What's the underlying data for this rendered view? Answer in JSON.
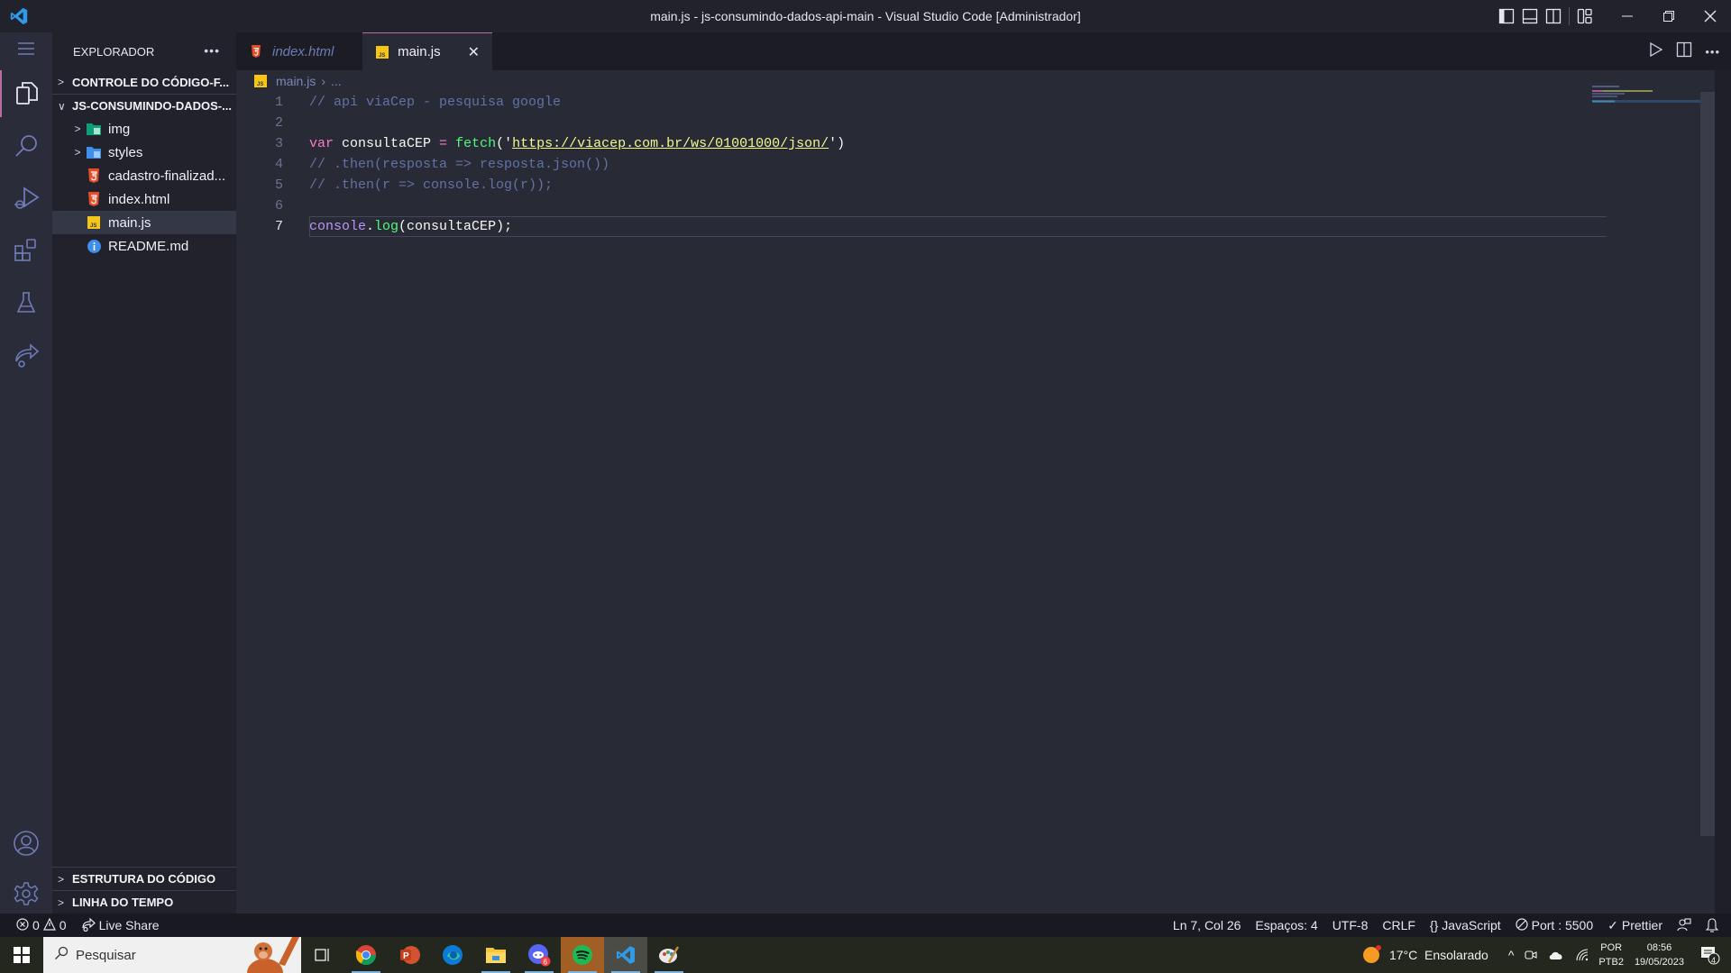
{
  "window": {
    "title": "main.js - js-consumindo-dados-api-main - Visual Studio Code [Administrador]"
  },
  "sidebar": {
    "header": "EXPLORADOR",
    "sections": {
      "source_control": "CONTROLE DO CÓDIGO-F...",
      "project": "JS-CONSUMINDO-DADOS-...",
      "outline": "ESTRUTURA DO CÓDIGO",
      "timeline": "LINHA DO TEMPO"
    },
    "files": [
      {
        "name": "img",
        "type": "folder-img"
      },
      {
        "name": "styles",
        "type": "folder-styles"
      },
      {
        "name": "cadastro-finalizad...",
        "type": "html"
      },
      {
        "name": "index.html",
        "type": "html"
      },
      {
        "name": "main.js",
        "type": "js",
        "selected": true
      },
      {
        "name": "README.md",
        "type": "info"
      }
    ]
  },
  "tabs": [
    {
      "label": "index.html",
      "type": "html",
      "active": false
    },
    {
      "label": "main.js",
      "type": "js",
      "active": true
    }
  ],
  "breadcrumb": {
    "file": "main.js",
    "rest": "..."
  },
  "editor": {
    "lines": [
      {
        "n": "1",
        "comment": "// api viaCep - pesquisa google"
      },
      {
        "n": "2"
      },
      {
        "n": "3",
        "kw": "var",
        "name": " consultaCEP ",
        "eq": "=",
        "fn": " fetch",
        "p1": "('",
        "str": "https://viacep.com.br/ws/01001000/json/",
        "p2": "')"
      },
      {
        "n": "4",
        "comment": "// .then(resposta => resposta.json())"
      },
      {
        "n": "5",
        "comment": "// .then(r => console.log(r));"
      },
      {
        "n": "6"
      },
      {
        "n": "7",
        "obj": "console",
        "dot": ".",
        "fn": "log",
        "rest": "(consultaCEP);"
      }
    ],
    "current_line": 7
  },
  "statusbar": {
    "errors": "0",
    "warnings": "0",
    "live_share": "Live Share",
    "position": "Ln 7, Col 26",
    "spaces": "Espaços: 4",
    "encoding": "UTF-8",
    "eol": "CRLF",
    "language": "JavaScript",
    "port": "Port : 5500",
    "prettier": "Prettier"
  },
  "taskbar": {
    "search_placeholder": "Pesquisar",
    "weather": "17°C  Ensolarado",
    "lang_top": "POR",
    "lang_bottom": "PTB2",
    "time": "08:56",
    "date": "19/05/2023",
    "notifications": "4",
    "discord_badge": "6"
  },
  "colors": {
    "accent": "#b56ea0",
    "editor_bg": "#282a36",
    "sidebar_bg": "#21222c",
    "statusbar_bg": "#191a21"
  }
}
